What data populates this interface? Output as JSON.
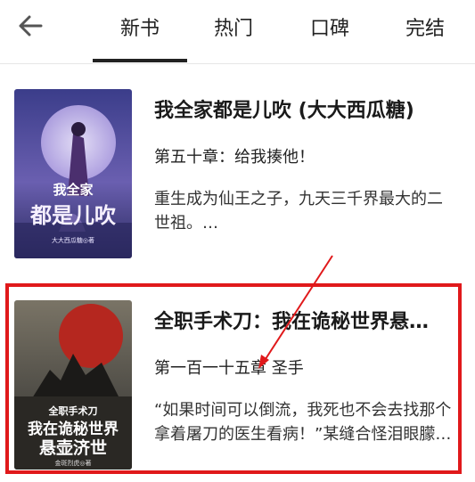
{
  "tabs": [
    {
      "label": "新书"
    },
    {
      "label": "热门"
    },
    {
      "label": "口碑"
    },
    {
      "label": "完结"
    }
  ],
  "books": [
    {
      "title": "我全家都是儿吹 (大大西瓜糖)",
      "chapter": "第五十章：给我揍他！",
      "description": "重生成为仙王之子，九天三千界最大的二世祖。…",
      "cover_text": [
        "我全家",
        "都是儿吹",
        "大大西瓜糖◎著"
      ]
    },
    {
      "title": "全职手术刀：我在诡秘世界悬…",
      "chapter": "第一百一十五章  圣手",
      "description": "“如果时间可以倒流，我死也不会去找那个拿着屠刀的医生看病！”某缝合怪泪眼朦…",
      "cover_text": [
        "全职手术刀",
        "我在诡秘世界",
        "悬壶济世",
        "金斑烈虎◎著"
      ]
    }
  ],
  "colors": {
    "highlight": "#e0191b",
    "tab_underline": "#222222"
  },
  "icons": {
    "back": "back-arrow-icon"
  }
}
